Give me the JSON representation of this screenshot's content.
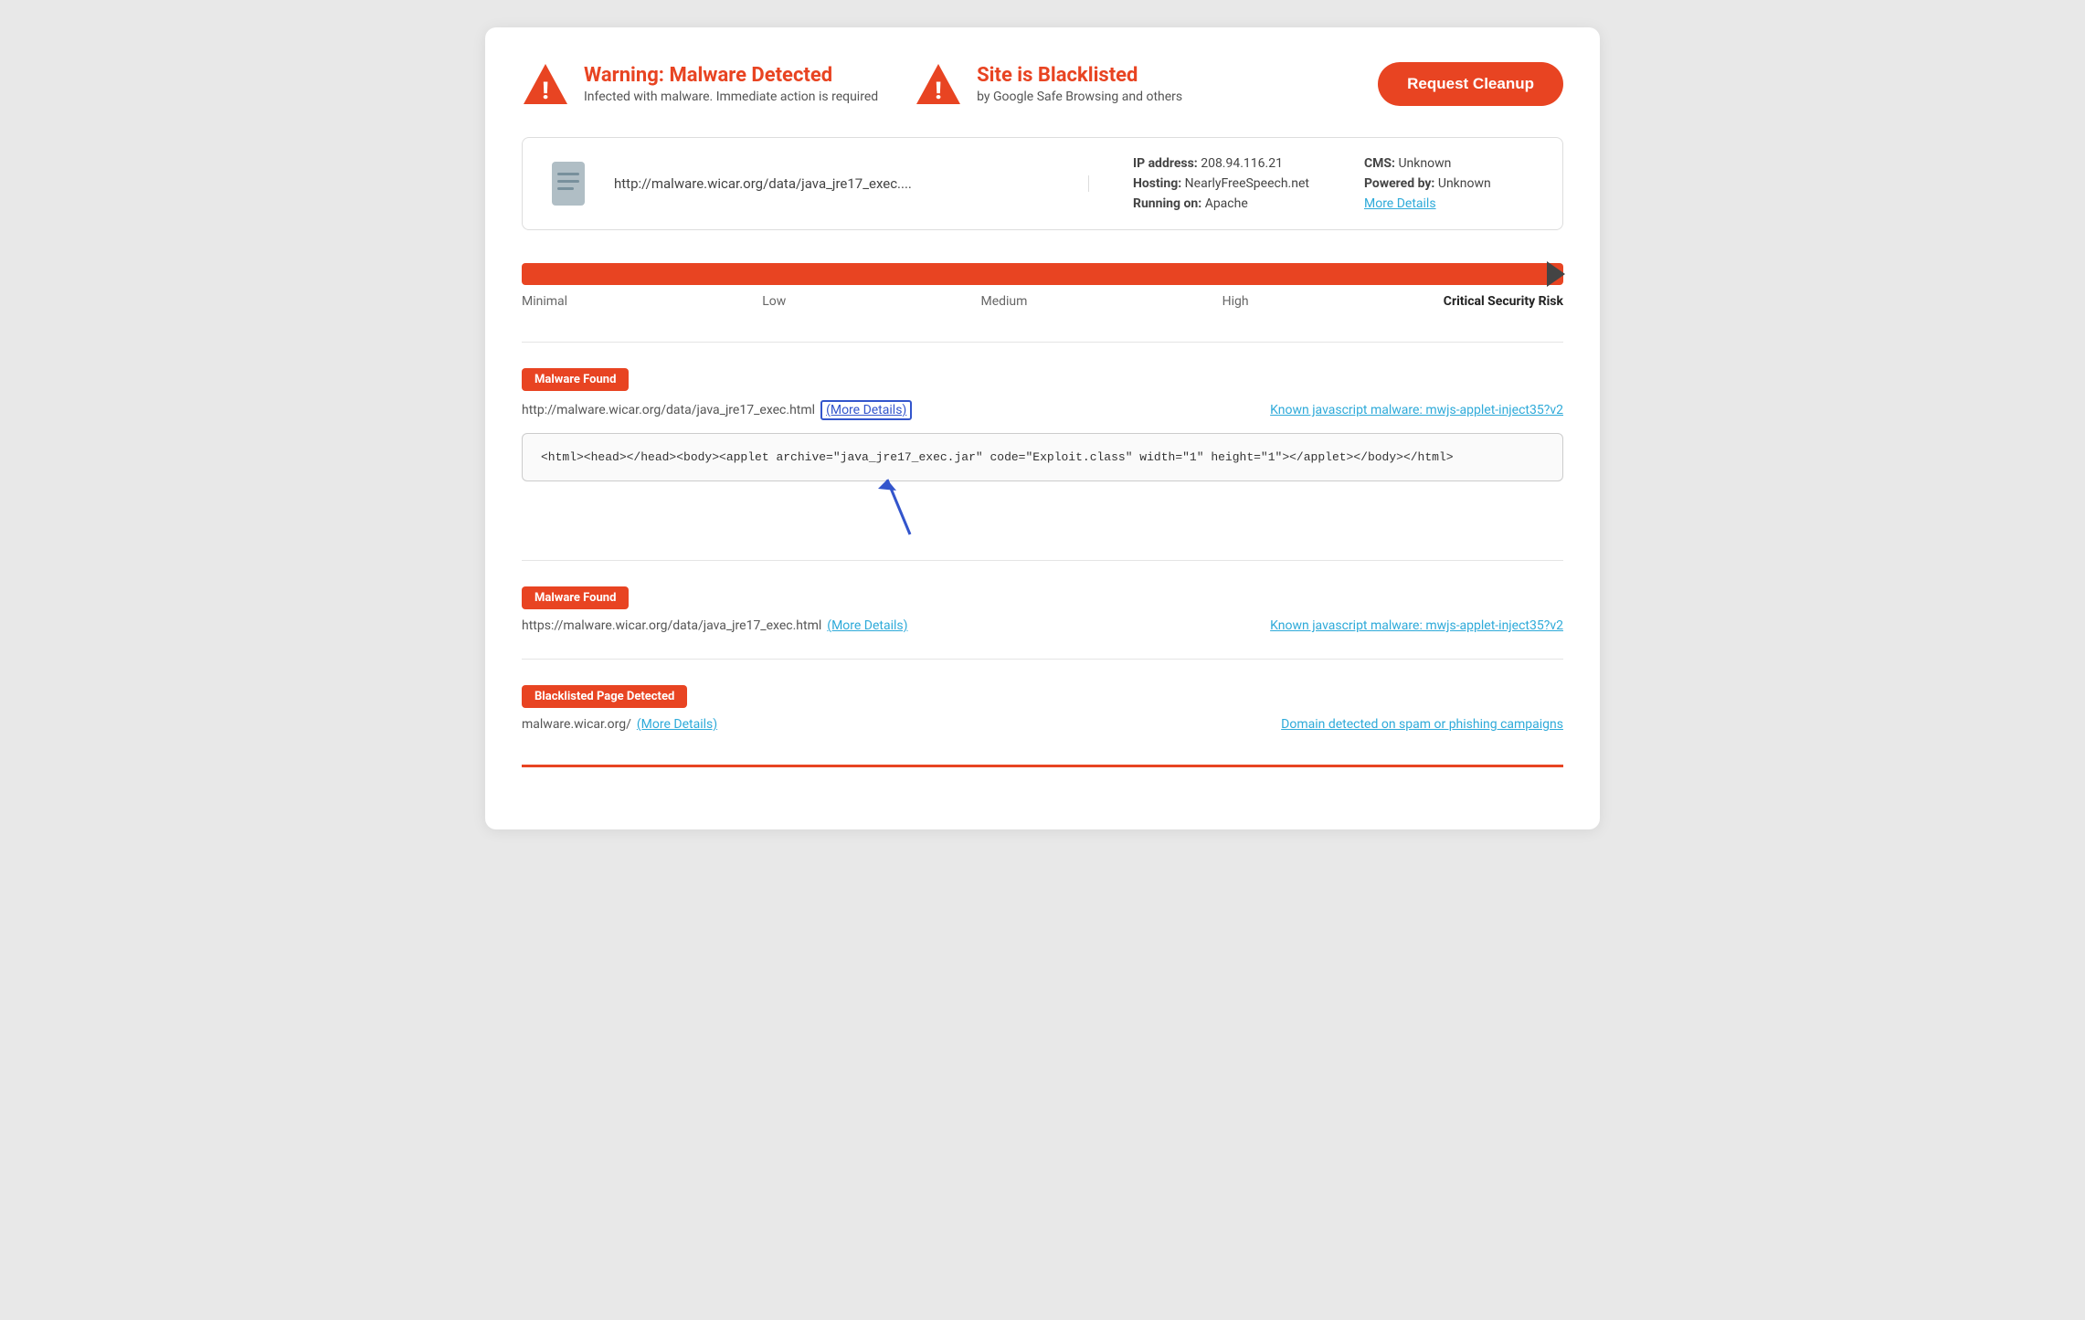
{
  "header": {
    "warning_title": "Warning: Malware Detected",
    "warning_sub": "Infected with malware. Immediate action is required",
    "blacklist_title": "Site is Blacklisted",
    "blacklist_sub": "by Google Safe Browsing and others",
    "cleanup_btn": "Request Cleanup"
  },
  "site_info": {
    "url": "http://malware.wicar.org/data/java_jre17_exec....",
    "ip_label": "IP address:",
    "ip_value": "208.94.116.21",
    "hosting_label": "Hosting:",
    "hosting_value": "NearlyFreeSpeech.net",
    "running_label": "Running on:",
    "running_value": "Apache",
    "cms_label": "CMS:",
    "cms_value": "Unknown",
    "powered_label": "Powered by:",
    "powered_value": "Unknown",
    "more_details": "More Details"
  },
  "risk": {
    "minimal": "Minimal",
    "low": "Low",
    "medium": "Medium",
    "high": "High",
    "critical": "Critical Security Risk"
  },
  "findings": [
    {
      "badge": "Malware Found",
      "url": "http://malware.wicar.org/data/java_jre17_exec.html",
      "more_details_text": "(More Details)",
      "known_malware": "Known javascript malware: mwjs-applet-inject35?v2",
      "code": "<html><head></head><body><applet archive=\"java_jre17_exec.jar\" code=\"Exploit.class\" width=\"1\" height=\"1\"></applet></body></html>",
      "has_code": true,
      "has_arrow": true
    },
    {
      "badge": "Malware Found",
      "url": "https://malware.wicar.org/data/java_jre17_exec.html",
      "more_details_text": "(More Details)",
      "known_malware": "Known javascript malware: mwjs-applet-inject35?v2",
      "has_code": false,
      "has_arrow": false
    },
    {
      "badge": "Blacklisted Page Detected",
      "url": "malware.wicar.org/",
      "more_details_text": "(More Details)",
      "known_malware": "Domain detected on spam or phishing campaigns",
      "has_code": false,
      "has_arrow": false,
      "is_blacklist": true
    }
  ],
  "colors": {
    "accent": "#e84422",
    "link": "#2eaad9"
  }
}
